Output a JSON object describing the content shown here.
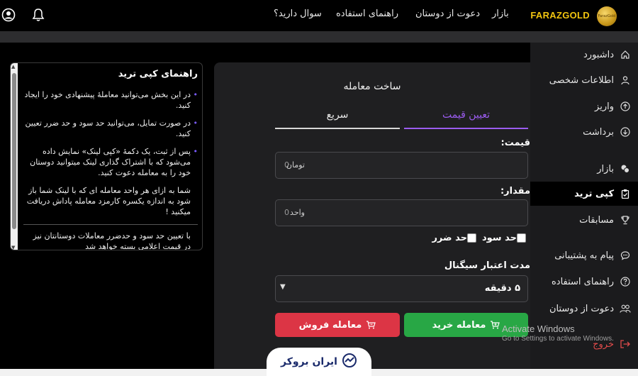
{
  "header": {
    "brand_name": "FARAZGOLD",
    "logo_text": "FarazGold",
    "nav": [
      "بازار",
      "دعوت از دوستان",
      "راهنمای استفاده",
      "سوال دارید؟"
    ]
  },
  "sidebar": {
    "items": [
      {
        "label": "داشبورد",
        "icon": "home-icon"
      },
      {
        "label": "اطلاعات شخصی",
        "icon": "user-icon"
      },
      {
        "label": "واریز",
        "icon": "arrow-up-circle-icon"
      },
      {
        "label": "برداشت",
        "icon": "arrow-down-circle-icon"
      },
      {
        "label": "بازار",
        "icon": "coins-icon"
      },
      {
        "label": "کپی ترید",
        "icon": "clipboard-icon"
      },
      {
        "label": "مسابقات",
        "icon": "trophy-icon"
      },
      {
        "label": "پیام به پشتیبانی",
        "icon": "chat-icon"
      },
      {
        "label": "راهنمای استفاده",
        "icon": "question-icon"
      },
      {
        "label": "دعوت از دوستان",
        "icon": "users-icon"
      },
      {
        "label": "خروج",
        "icon": "logout-icon"
      }
    ],
    "active": "کپی ترید"
  },
  "form": {
    "title": "ساخت معامله",
    "tabs": [
      "تعیین قیمت",
      "سریع"
    ],
    "price_label": "قیمت:",
    "price_value": "0",
    "price_unit": "تومان",
    "amount_label": "مقدار:",
    "amount_value": "0",
    "amount_unit": "واحد",
    "take_profit_label": "حد سود",
    "stop_loss_label": "حد ضرر",
    "validity_label": "مدت اعتبار سیگنال",
    "validity_value": "۵ دقیقه",
    "buy_label": "معامله خرید",
    "sell_label": "معامله فروش"
  },
  "guide": {
    "title": "راهنمای کپی ترید",
    "items": [
      "در این بخش می‌توانید معاملهٔ پیشنهادی خود را ایجاد کنید.",
      "در صورت تمایل، می‌توانید حد سود و حد ضرر تعیین کنید.",
      "پس از ثبت، یک دکمهٔ «کپی لینک» نمایش داده می‌شود که با اشتراک گذاری لینک میتوانید دوستان خود را به معامله دعوت کنید."
    ],
    "note": "شما به ازای هر واحد معامله ای که با لینک شما باز شود به اندازه یکسره کارمزد معامله پاداش دریافت میکنید !",
    "footer": "با تعیین حد سود و حدضرر معاملات دوستانتان نیز در قیمت اعلامی بسته خواهد شد"
  },
  "watermark": {
    "line1": "Activate Windows",
    "line2": "Go to Settings to activate Windows."
  },
  "footer_logo": "ایران بروکر",
  "colors": {
    "accent": "#9b5cf0",
    "buy": "#28a745",
    "sell": "#dc3545",
    "brand": "#f1c40f"
  }
}
